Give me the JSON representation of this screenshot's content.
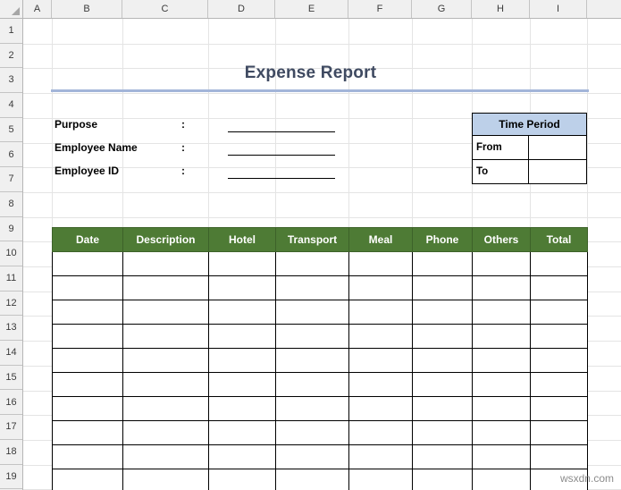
{
  "spreadsheet": {
    "column_headers": [
      "A",
      "B",
      "C",
      "D",
      "E",
      "F",
      "G",
      "H",
      "I"
    ],
    "row_headers": [
      "1",
      "2",
      "3",
      "4",
      "5",
      "6",
      "7",
      "8",
      "9",
      "10",
      "11",
      "12",
      "13",
      "14",
      "15",
      "16",
      "17",
      "18",
      "19"
    ]
  },
  "title": "Expense Report",
  "form": {
    "colon": ":",
    "fields": [
      {
        "label": "Purpose",
        "value": ""
      },
      {
        "label": "Employee Name",
        "value": ""
      },
      {
        "label": "Employee ID",
        "value": ""
      }
    ]
  },
  "time_period": {
    "header": "Time Period",
    "rows": [
      {
        "label": "From",
        "value": ""
      },
      {
        "label": "To",
        "value": ""
      }
    ]
  },
  "expense_table": {
    "columns": [
      "Date",
      "Description",
      "Hotel",
      "Transport",
      "Meal",
      "Phone",
      "Others",
      "Total"
    ],
    "rows": [
      [
        "",
        "",
        "",
        "",
        "",
        "",
        "",
        ""
      ],
      [
        "",
        "",
        "",
        "",
        "",
        "",
        "",
        ""
      ],
      [
        "",
        "",
        "",
        "",
        "",
        "",
        "",
        ""
      ],
      [
        "",
        "",
        "",
        "",
        "",
        "",
        "",
        ""
      ],
      [
        "",
        "",
        "",
        "",
        "",
        "",
        "",
        ""
      ],
      [
        "",
        "",
        "",
        "",
        "",
        "",
        "",
        ""
      ],
      [
        "",
        "",
        "",
        "",
        "",
        "",
        "",
        ""
      ],
      [
        "",
        "",
        "",
        "",
        "",
        "",
        "",
        ""
      ],
      [
        "",
        "",
        "",
        "",
        "",
        "",
        "",
        ""
      ],
      [
        "",
        "",
        "",
        "",
        "",
        "",
        "",
        ""
      ]
    ]
  },
  "watermark": "wsxdn.com",
  "colors": {
    "header_green": "#4e7b35",
    "title_text": "#3f4a61",
    "title_rule": "#a3b5d9",
    "time_period_fill": "#bdd0e9",
    "grid_line": "#e4e4e4",
    "border_black": "#000000"
  }
}
